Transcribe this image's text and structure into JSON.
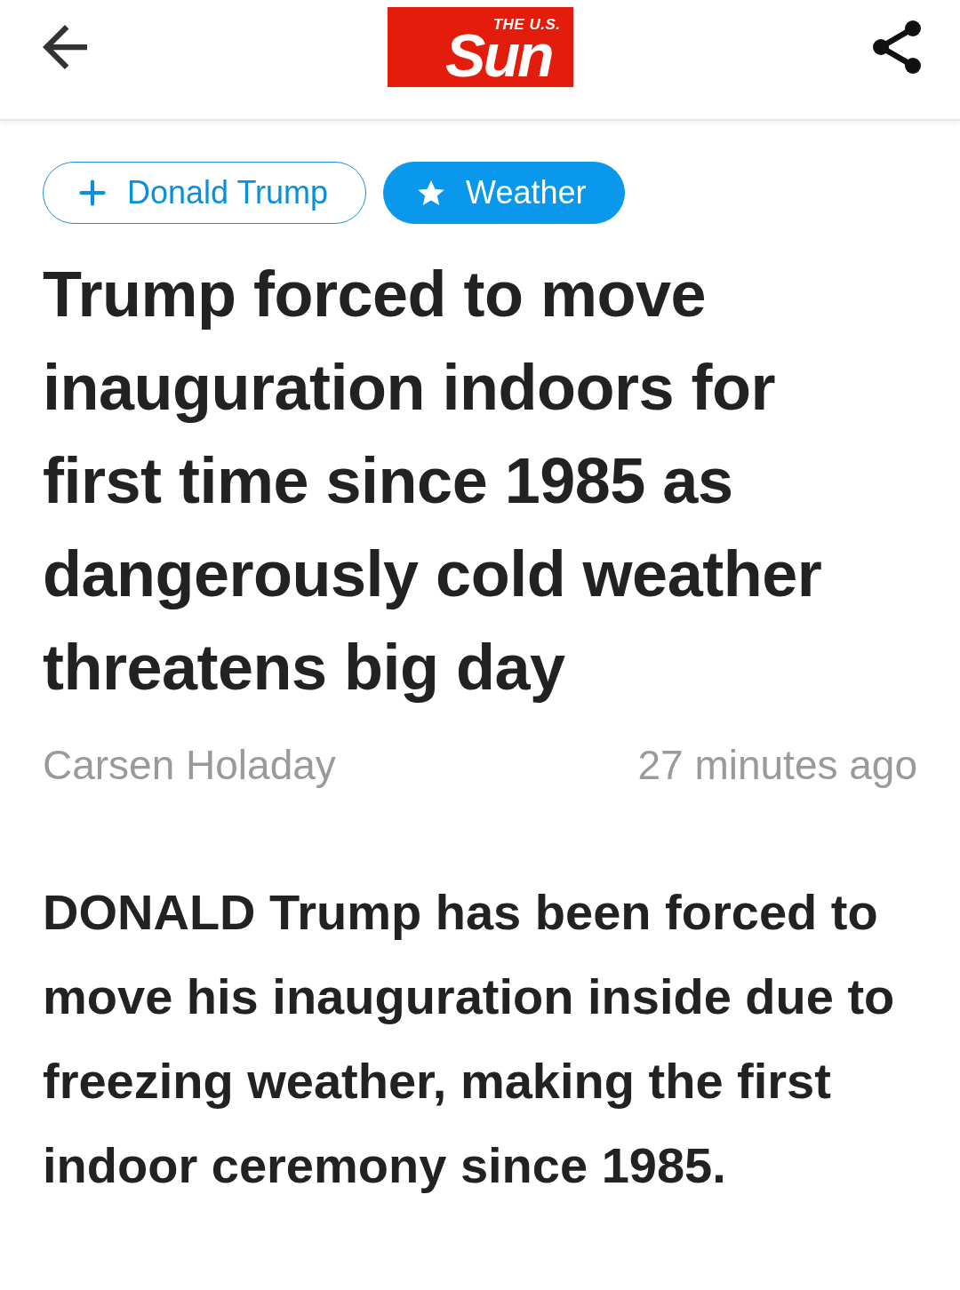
{
  "header": {
    "logo": {
      "overline": "THE U.S.",
      "name": "Sun"
    }
  },
  "topics": [
    {
      "label": "Donald Trump",
      "followed": false
    },
    {
      "label": "Weather",
      "followed": true
    }
  ],
  "article": {
    "headline": "Trump forced to move inauguration indoors for first time since 1985 as dangerously cold weather threatens big day",
    "author": "Carsen Holaday",
    "time": "27 minutes ago",
    "lead": "DONALD Trump has been forced to move his inauguration inside due to freezing weather, making the first indoor ceremony since 1985."
  }
}
